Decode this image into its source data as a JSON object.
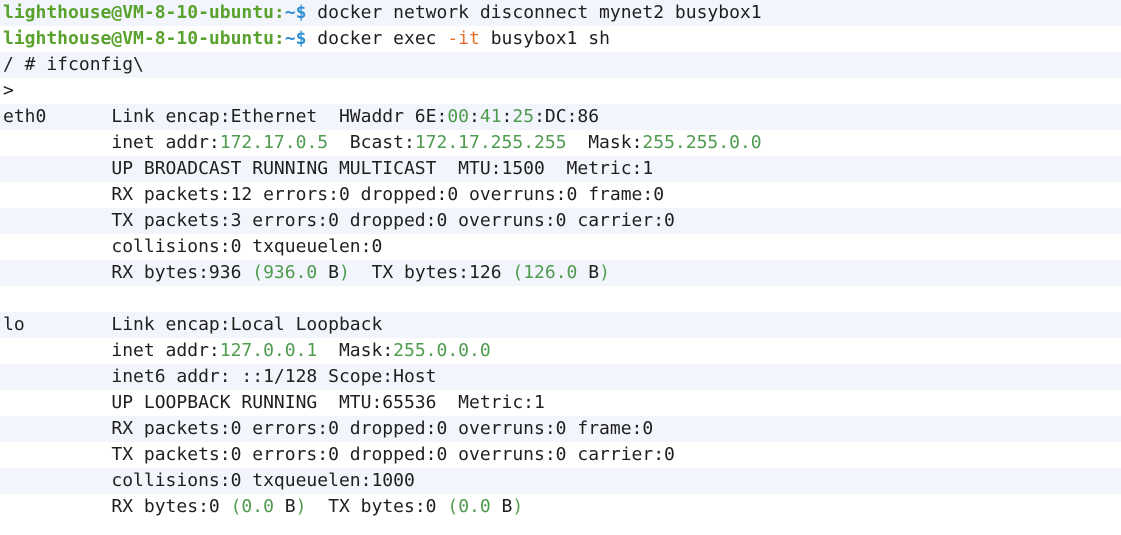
{
  "terminal": {
    "lines": [
      [
        {
          "t": "lighthouse@VM-8-10-ubuntu:",
          "c": "prompt"
        },
        {
          "t": "~$",
          "c": "path"
        },
        {
          "t": " docker network disconnect mynet2 busybox1",
          "c": "text"
        }
      ],
      [
        {
          "t": "lighthouse@VM-8-10-ubuntu:",
          "c": "prompt"
        },
        {
          "t": "~$",
          "c": "path"
        },
        {
          "t": " docker exec ",
          "c": "text"
        },
        {
          "t": "-it",
          "c": "flag"
        },
        {
          "t": " busybox1 sh",
          "c": "text"
        }
      ],
      [
        {
          "t": "/ # ifconfig\\",
          "c": "text"
        }
      ],
      [
        {
          "t": ">",
          "c": "text"
        }
      ],
      [
        {
          "t": "eth0      Link encap:Ethernet  HWaddr 6E:",
          "c": "text"
        },
        {
          "t": "00",
          "c": "num"
        },
        {
          "t": ":",
          "c": "text"
        },
        {
          "t": "41",
          "c": "num"
        },
        {
          "t": ":",
          "c": "text"
        },
        {
          "t": "25",
          "c": "num"
        },
        {
          "t": ":DC:86",
          "c": "text"
        }
      ],
      [
        {
          "t": "          inet addr:",
          "c": "text"
        },
        {
          "t": "172.17.0.5",
          "c": "num"
        },
        {
          "t": "  Bcast:",
          "c": "text"
        },
        {
          "t": "172.17.255.255",
          "c": "num"
        },
        {
          "t": "  Mask:",
          "c": "text"
        },
        {
          "t": "255.255.0.0",
          "c": "num"
        }
      ],
      [
        {
          "t": "          UP BROADCAST RUNNING MULTICAST  MTU:1500  Metric:1",
          "c": "text"
        }
      ],
      [
        {
          "t": "          RX packets:12 errors:0 dropped:0 overruns:0 frame:0",
          "c": "text"
        }
      ],
      [
        {
          "t": "          TX packets:3 errors:0 dropped:0 overruns:0 carrier:0",
          "c": "text"
        }
      ],
      [
        {
          "t": "          collisions:0 txqueuelen:0",
          "c": "text"
        }
      ],
      [
        {
          "t": "          RX bytes:936 ",
          "c": "text"
        },
        {
          "t": "(936.0",
          "c": "num"
        },
        {
          "t": " B",
          "c": "text"
        },
        {
          "t": ")",
          "c": "num"
        },
        {
          "t": "  TX bytes:126 ",
          "c": "text"
        },
        {
          "t": "(126.0",
          "c": "num"
        },
        {
          "t": " B",
          "c": "text"
        },
        {
          "t": ")",
          "c": "num"
        }
      ],
      [
        {
          "t": "",
          "c": "text"
        }
      ],
      [
        {
          "t": "lo        Link encap:Local Loopback",
          "c": "text"
        }
      ],
      [
        {
          "t": "          inet addr:",
          "c": "text"
        },
        {
          "t": "127.0.0.1",
          "c": "num"
        },
        {
          "t": "  Mask:",
          "c": "text"
        },
        {
          "t": "255.0.0.0",
          "c": "num"
        }
      ],
      [
        {
          "t": "          inet6 addr: ::1/128 Scope:Host",
          "c": "text"
        }
      ],
      [
        {
          "t": "          UP LOOPBACK RUNNING  MTU:65536  Metric:1",
          "c": "text"
        }
      ],
      [
        {
          "t": "          RX packets:0 errors:0 dropped:0 overruns:0 frame:0",
          "c": "text"
        }
      ],
      [
        {
          "t": "          TX packets:0 errors:0 dropped:0 overruns:0 carrier:0",
          "c": "text"
        }
      ],
      [
        {
          "t": "          collisions:0 txqueuelen:1000",
          "c": "text"
        }
      ],
      [
        {
          "t": "          RX bytes:0 ",
          "c": "text"
        },
        {
          "t": "(0.0",
          "c": "num"
        },
        {
          "t": " B",
          "c": "text"
        },
        {
          "t": ")",
          "c": "num"
        },
        {
          "t": "  TX bytes:0 ",
          "c": "text"
        },
        {
          "t": "(0.0",
          "c": "num"
        },
        {
          "t": " B",
          "c": "text"
        },
        {
          "t": ")",
          "c": "num"
        }
      ]
    ]
  },
  "colors": {
    "background": "#ffffff",
    "row_stripe": "#f2f5fb",
    "prompt_user": "#5aa22e",
    "prompt_path": "#2f8fd4",
    "flag": "#e66f2a",
    "number": "#4f9b4f",
    "text": "#1f1f1f"
  }
}
